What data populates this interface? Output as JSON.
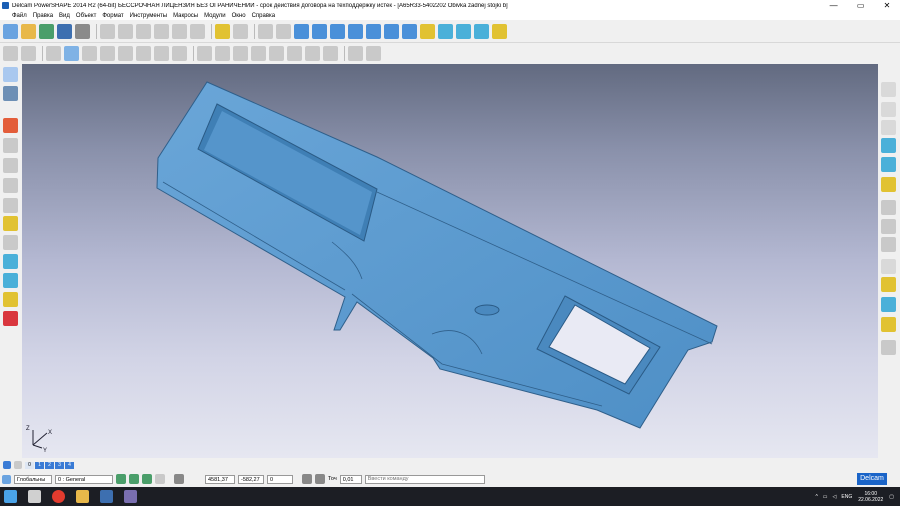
{
  "window": {
    "title": "Delcam PowerSHAPE 2014 R2 (64-bit) БЕССРОЧНАЯ ЛИЦЕНЗИЯ БЕЗ ОГРАНИЧЕНИЙ - срок действия договора на техподдержку истек - [A65R33-5402202 Obivka zadnej stojki b]",
    "minimize": "—",
    "maximize": "▭",
    "close": "✕"
  },
  "menu": [
    "Файл",
    "Правка",
    "Вид",
    "Объект",
    "Формат",
    "Инструменты",
    "Макросы",
    "Модули",
    "Окно",
    "Справка"
  ],
  "levels": {
    "numbers": [
      "0",
      "1",
      "2",
      "3",
      "4"
    ]
  },
  "status": {
    "workplane": "Глобальны",
    "level_combo": "0 : General",
    "coord_x": "4581,37",
    "coord_y": "-582,27",
    "coord_z": "0",
    "tolerance_label": "Точ",
    "tolerance": "0,01",
    "command_placeholder": "Ввести команду",
    "brand": "Delcam"
  },
  "axes": {
    "x": "X",
    "y": "Y",
    "z": "Z"
  },
  "taskbar": {
    "lang": "ENG",
    "time": "16:00",
    "date": "22.06.2022"
  },
  "colors": {
    "part_fill": "#5b9bd2",
    "accent": "#1a64c8"
  }
}
